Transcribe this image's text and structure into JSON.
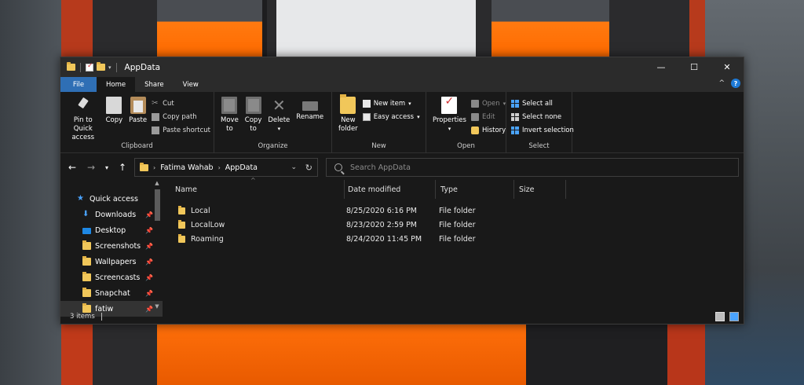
{
  "window": {
    "title": "AppData",
    "controls": {
      "minimize": "—",
      "maximize": "☐",
      "close": "✕"
    }
  },
  "ribbon_tabs": [
    "File",
    "Home",
    "Share",
    "View"
  ],
  "ribbon": {
    "clipboard": {
      "label": "Clipboard",
      "pin_line1": "Pin to Quick",
      "pin_line2": "access",
      "copy": "Copy",
      "paste": "Paste",
      "cut": "Cut",
      "copy_path": "Copy path",
      "paste_shortcut": "Paste shortcut"
    },
    "organize": {
      "label": "Organize",
      "move_line1": "Move",
      "move_line2": "to",
      "copy_line1": "Copy",
      "copy_line2": "to",
      "delete": "Delete",
      "rename": "Rename"
    },
    "new": {
      "label": "New",
      "new_folder_line1": "New",
      "new_folder_line2": "folder",
      "new_item": "New item",
      "easy_access": "Easy access"
    },
    "open": {
      "label": "Open",
      "properties": "Properties",
      "open": "Open",
      "edit": "Edit",
      "history": "History"
    },
    "select": {
      "label": "Select",
      "select_all": "Select all",
      "select_none": "Select none",
      "invert_selection": "Invert selection"
    }
  },
  "address": {
    "crumbs": [
      "Fatima Wahab",
      "AppData"
    ],
    "search_placeholder": "Search AppData"
  },
  "nav_pane": {
    "quick_access": "Quick access",
    "items": [
      {
        "label": "Downloads",
        "icon": "download-icon"
      },
      {
        "label": "Desktop",
        "icon": "desktop-icon"
      },
      {
        "label": "Screenshots",
        "icon": "folder-icon"
      },
      {
        "label": "Wallpapers",
        "icon": "folder-icon"
      },
      {
        "label": "Screencasts",
        "icon": "folder-icon"
      },
      {
        "label": "Snapchat",
        "icon": "folder-icon"
      },
      {
        "label": "fatiw",
        "icon": "folder-icon"
      }
    ]
  },
  "file_list": {
    "columns": [
      "Name",
      "Date modified",
      "Type",
      "Size"
    ],
    "rows": [
      {
        "name": "Local",
        "date": "8/25/2020 6:16 PM",
        "type": "File folder",
        "size": ""
      },
      {
        "name": "LocalLow",
        "date": "8/23/2020 2:59 PM",
        "type": "File folder",
        "size": ""
      },
      {
        "name": "Roaming",
        "date": "8/24/2020 11:45 PM",
        "type": "File folder",
        "size": ""
      }
    ]
  },
  "status": {
    "count": "3 items"
  },
  "colors": {
    "file_tab": "#2f6fb5",
    "folder": "#f1c75a",
    "accent": "#4aa3ff",
    "window_bg": "#191919"
  }
}
